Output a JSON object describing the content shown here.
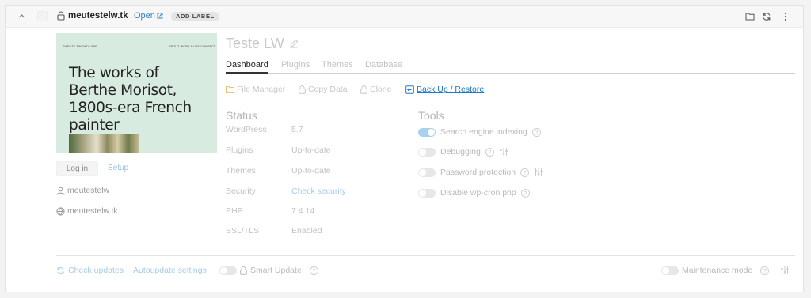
{
  "header": {
    "domain": "meutestelw.tk",
    "open_label": "Open",
    "add_label": "ADD LABEL"
  },
  "thumbnail": {
    "brand": "TWENTY TWENTY-ONE",
    "nav": "ABOUT   WORK   BLOG   CONTACT",
    "headline": "The works of Berthe Morisot, 1800s-era French painter"
  },
  "side": {
    "login_label": "Log in",
    "setup_label": "Setup",
    "username": "meutestelw",
    "site_url": "meutestelw.tk"
  },
  "site_title": "Teste LW",
  "tabs": [
    {
      "label": "Dashboard",
      "active": true
    },
    {
      "label": "Plugins",
      "active": false
    },
    {
      "label": "Themes",
      "active": false
    },
    {
      "label": "Database",
      "active": false
    }
  ],
  "actions": {
    "file_manager": "File Manager",
    "copy_data": "Copy Data",
    "clone": "Clone",
    "backup_restore": "Back Up / Restore"
  },
  "status": {
    "title": "Status",
    "rows": [
      {
        "label": "WordPress",
        "value": "5.7"
      },
      {
        "label": "Plugins",
        "value": "Up-to-date"
      },
      {
        "label": "Themes",
        "value": "Up-to-date"
      },
      {
        "label": "Security",
        "value": "Check security"
      },
      {
        "label": "PHP",
        "value": "7.4.14"
      },
      {
        "label": "SSL/TLS",
        "value": "Enabled"
      }
    ]
  },
  "tools": {
    "title": "Tools",
    "items": [
      {
        "label": "Search engine indexing",
        "on": true
      },
      {
        "label": "Debugging",
        "on": false
      },
      {
        "label": "Password protection",
        "on": false
      },
      {
        "label": "Disable wp-cron.php",
        "on": false
      }
    ]
  },
  "footer": {
    "check_updates": "Check updates",
    "autoupdate_settings": "Autoupdate settings",
    "smart_update": "Smart Update",
    "maintenance_mode": "Maintenance mode"
  },
  "colors": {
    "link": "#1f78c1",
    "toggle_on": "#a9d0ee",
    "thumbnail_bg": "#d7ebe1"
  }
}
